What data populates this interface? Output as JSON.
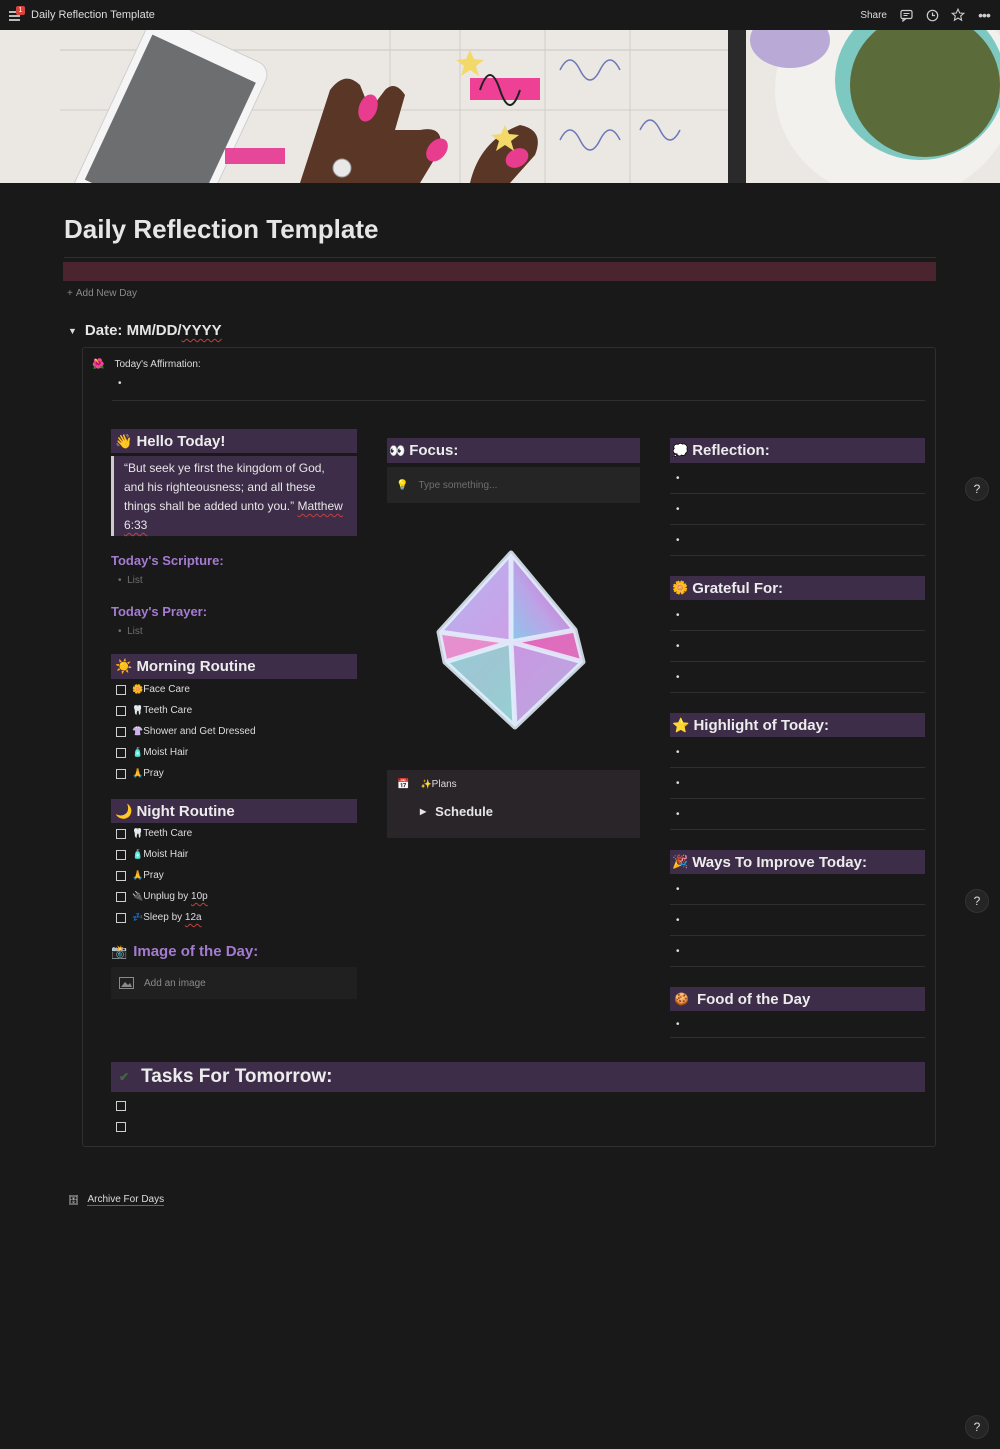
{
  "topbar": {
    "title": "Daily Reflection Template",
    "notif_count": "1",
    "share_label": "Share"
  },
  "page": {
    "title": "Daily Reflection Template",
    "add_new_day": "Add New Day"
  },
  "toggle": {
    "date_label": "Date: MM/DD/",
    "date_year": "YYYY"
  },
  "affirmation": {
    "label": "Today's Affirmation:"
  },
  "left": {
    "hello_title": "Hello Today!",
    "quote": "“But seek ye first the kingdom of God, and his righteousness; and all these things shall be added unto you.”",
    "quote_ref": "Matthew 6:33",
    "scripture_title": "Today's Scripture:",
    "scripture_placeholder": "List",
    "prayer_title": "Today's Prayer:",
    "prayer_placeholder": "List",
    "morning_title": "Morning Routine",
    "morning_items": [
      {
        "icon": "🌼",
        "label": "Face Care"
      },
      {
        "icon": "🦷",
        "label": "Teeth Care"
      },
      {
        "icon": "👚",
        "label": "Shower and Get Dressed"
      },
      {
        "icon": "🧴",
        "label": "Moist Hair"
      },
      {
        "icon": "🙏",
        "label": "Pray"
      }
    ],
    "night_title": "Night Routine",
    "night_items": [
      {
        "icon": "🦷",
        "label": "Teeth Care"
      },
      {
        "icon": "🧴",
        "label": "Moist Hair"
      },
      {
        "icon": "🙏",
        "label": "Pray"
      },
      {
        "icon": "🔌",
        "label": "Unplug by ",
        "tail": "10p"
      },
      {
        "icon": "💤",
        "label": "Sleep by ",
        "tail": "12a"
      }
    ],
    "image_title": "Image of the Day:",
    "add_image": "Add an image"
  },
  "middle": {
    "focus_title": "Focus:",
    "focus_placeholder": "Type something...",
    "plans_label": "Plans",
    "schedule_label": "Schedule"
  },
  "right": {
    "reflection_title": "Reflection:",
    "grateful_title": "Grateful For:",
    "highlight_title": "Highlight of Today:",
    "improve_title": "Ways To Improve Today:",
    "food_title": "Food of the Day"
  },
  "tasks": {
    "title": "Tasks For Tomorrow:"
  },
  "archive": {
    "label": "Archive For Days"
  },
  "help": {
    "label": "?"
  },
  "colors": {
    "bg": "#191919",
    "header": "#3e2d49",
    "maroon": "#4a2530",
    "accent_purple": "#a47bd1"
  }
}
